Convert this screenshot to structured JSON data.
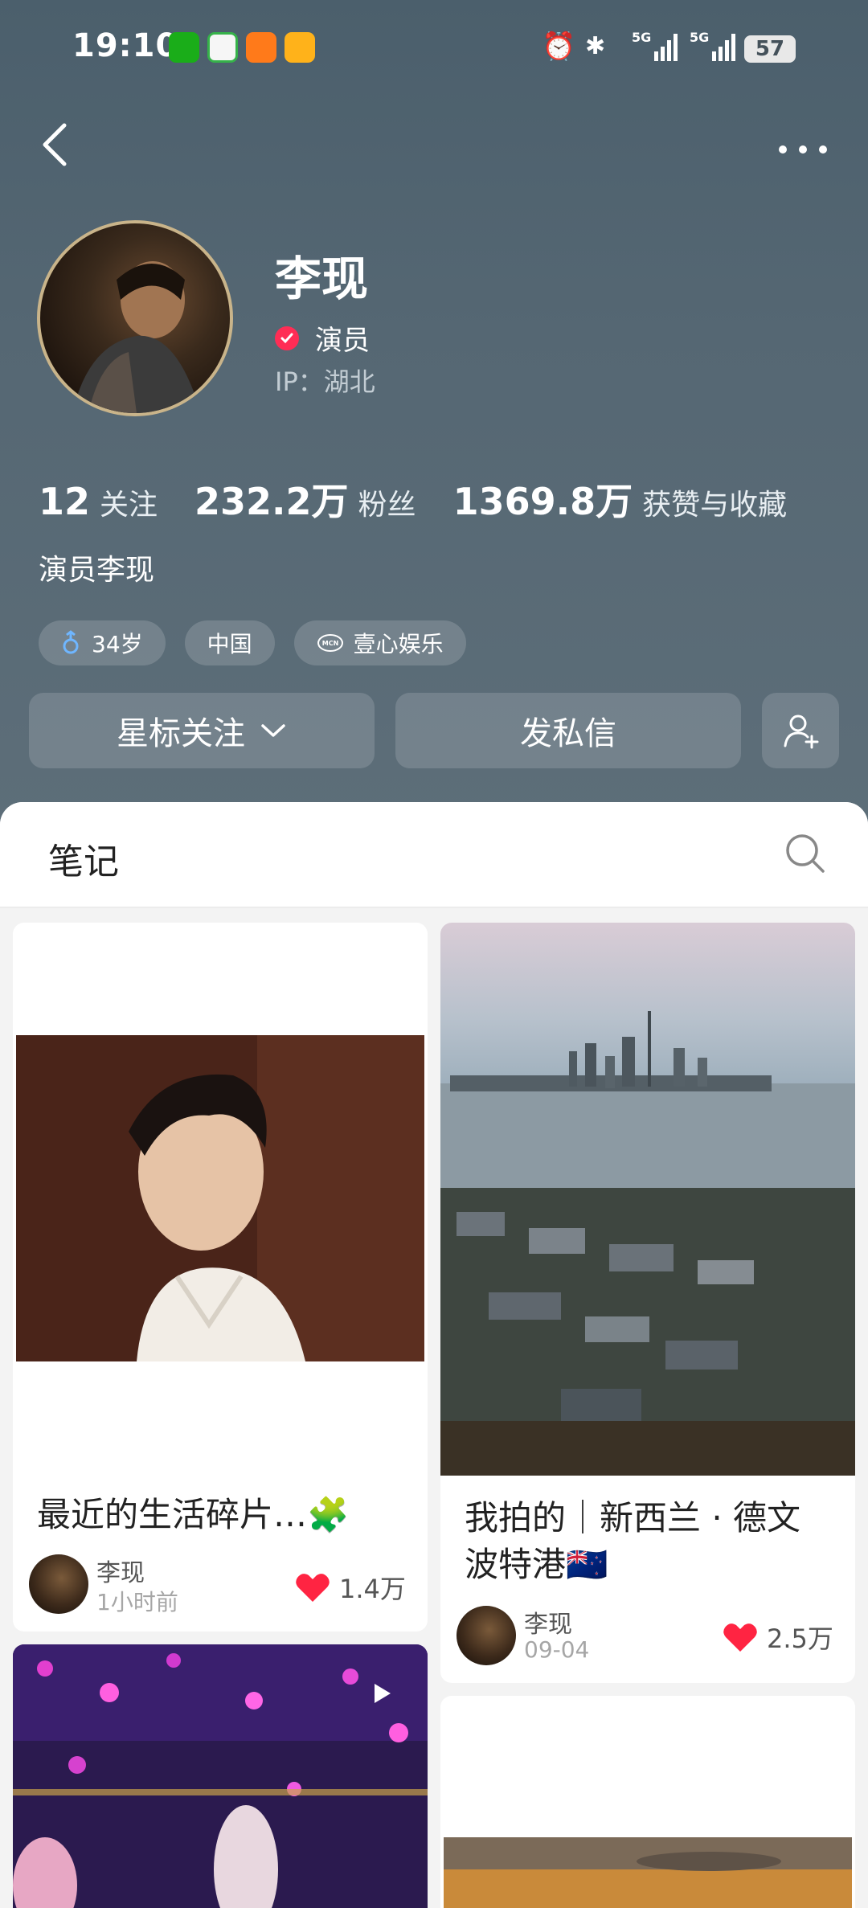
{
  "status_bar": {
    "time": "19:10",
    "battery": "57",
    "app_icons": [
      "wechat-icon",
      "video-app-icon",
      "runner-app-icon",
      "weibo-icon"
    ],
    "system_icons": [
      "alarm-icon",
      "bluetooth-icon",
      "5g-signal-icon",
      "5g-signal-icon"
    ]
  },
  "profile": {
    "name": "李现",
    "verified_label": "演员",
    "ip_label": "IP：湖北",
    "bio": "演员李现",
    "stats": [
      {
        "num": "12",
        "label": "关注"
      },
      {
        "num": "232.2万",
        "label": "粉丝"
      },
      {
        "num": "1369.8万",
        "label": "获赞与收藏"
      }
    ],
    "tags": [
      {
        "icon": "male-icon",
        "label": "34岁"
      },
      {
        "icon": "",
        "label": "中国"
      },
      {
        "icon": "mcn-icon",
        "label": "壹心娱乐"
      }
    ]
  },
  "actions": {
    "follow_label": "星标关注",
    "message_label": "发私信"
  },
  "tabs": {
    "notes_label": "笔记"
  },
  "notes": [
    {
      "title": "最近的生活碎片…🧩",
      "author": "李现",
      "date": "1小时前",
      "likes": "1.4万"
    },
    {
      "title": "我拍的｜新西兰 · 德文波特港🇳🇿",
      "author": "李现",
      "date": "09-04",
      "likes": "2.5万"
    }
  ],
  "colors": {
    "header": "#51636f",
    "accent_red": "#ff2442",
    "verified": "#ff2d55"
  }
}
